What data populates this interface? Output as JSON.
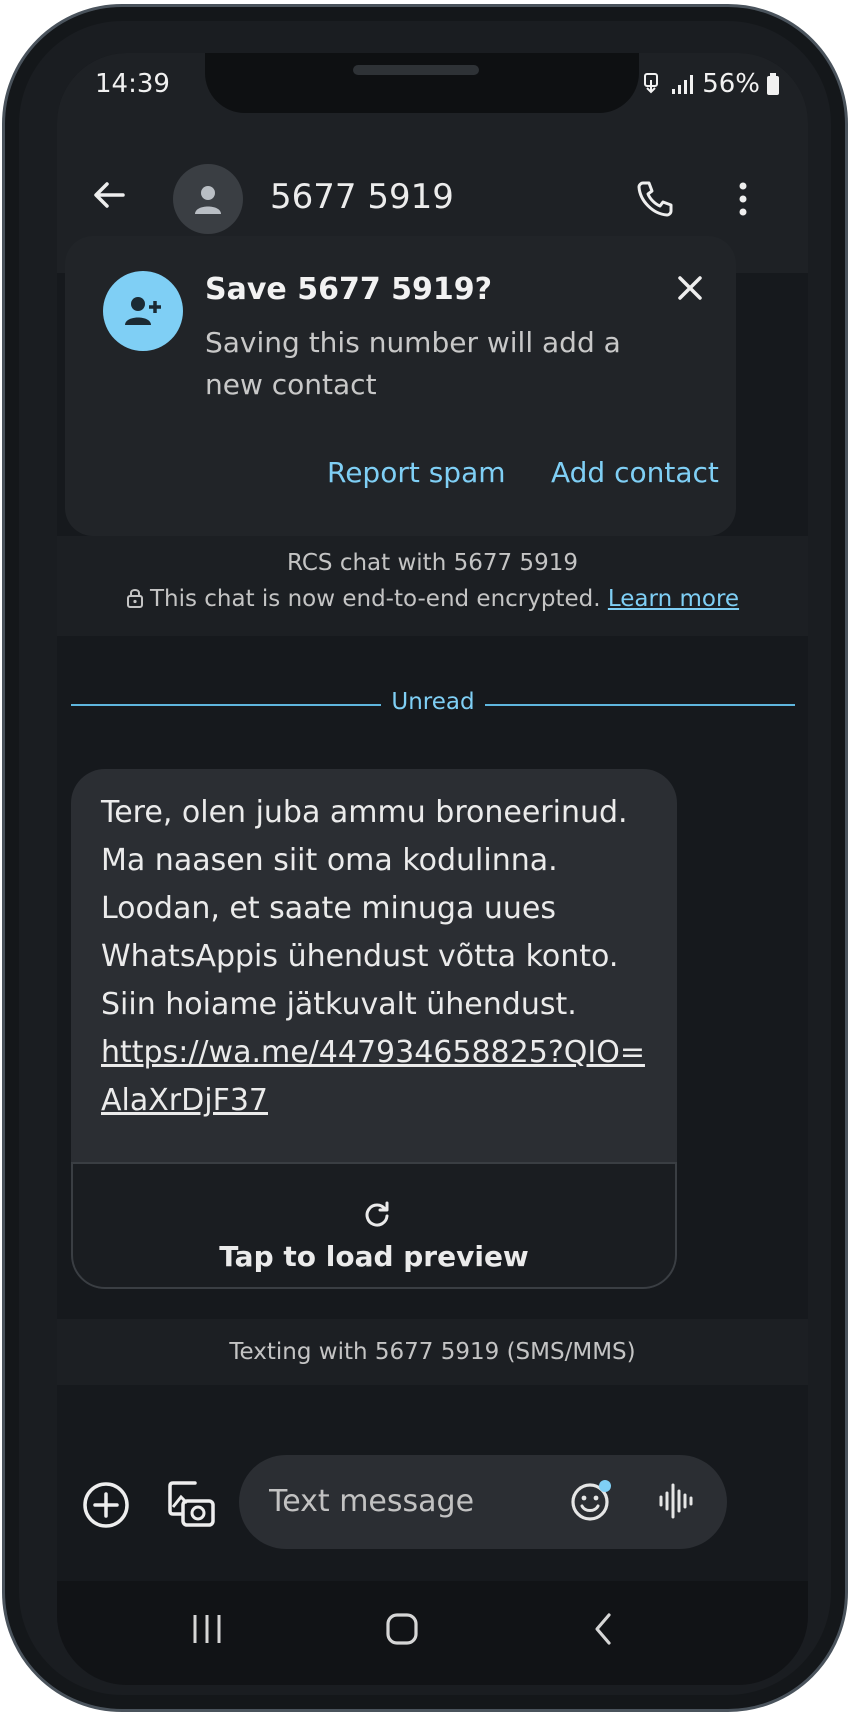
{
  "status_bar": {
    "time": "14:39",
    "battery": "56%",
    "icons": [
      "data-saver-icon",
      "signal-icon",
      "battery-icon"
    ]
  },
  "app_bar": {
    "title": "5677 5919",
    "icons": [
      "back-arrow-icon",
      "contact-avatar-icon",
      "phone-icon",
      "more-vert-icon"
    ]
  },
  "save_card": {
    "title": "Save 5677 5919?",
    "description": "Saving this number will add a new contact",
    "report_spam": "Report spam",
    "add_contact": "Add contact",
    "icons": [
      "person-add-icon",
      "close-icon"
    ]
  },
  "rcs_info": {
    "line1": "RCS chat with 5677 5919",
    "line2": "This chat is now end-to-end encrypted.",
    "learn_more": "Learn more"
  },
  "divider": {
    "label": "Unread"
  },
  "message": {
    "text": "Tere, olen juba ammu broneerinud. Ma naasen siit oma kodulinna. Loodan, et saate minuga uues WhatsAppis ühendust võtta konto. Siin hoiame jätkuvalt ühendust.",
    "link_line1": "https://wa.me/447934658825?QIO=",
    "link_line2": "AlaXrDjF37",
    "preview_label": "Tap to load preview"
  },
  "sms_info": {
    "text": "Texting with 5677 5919 (SMS/MMS)"
  },
  "composer": {
    "placeholder": "Text message",
    "icons": [
      "add-circle-icon",
      "gallery-camera-icon",
      "emoji-icon",
      "voice-waveform-icon"
    ]
  },
  "colors": {
    "accent": "#7fcff5",
    "background": "#16191d",
    "bubble": "#2b2e33"
  }
}
